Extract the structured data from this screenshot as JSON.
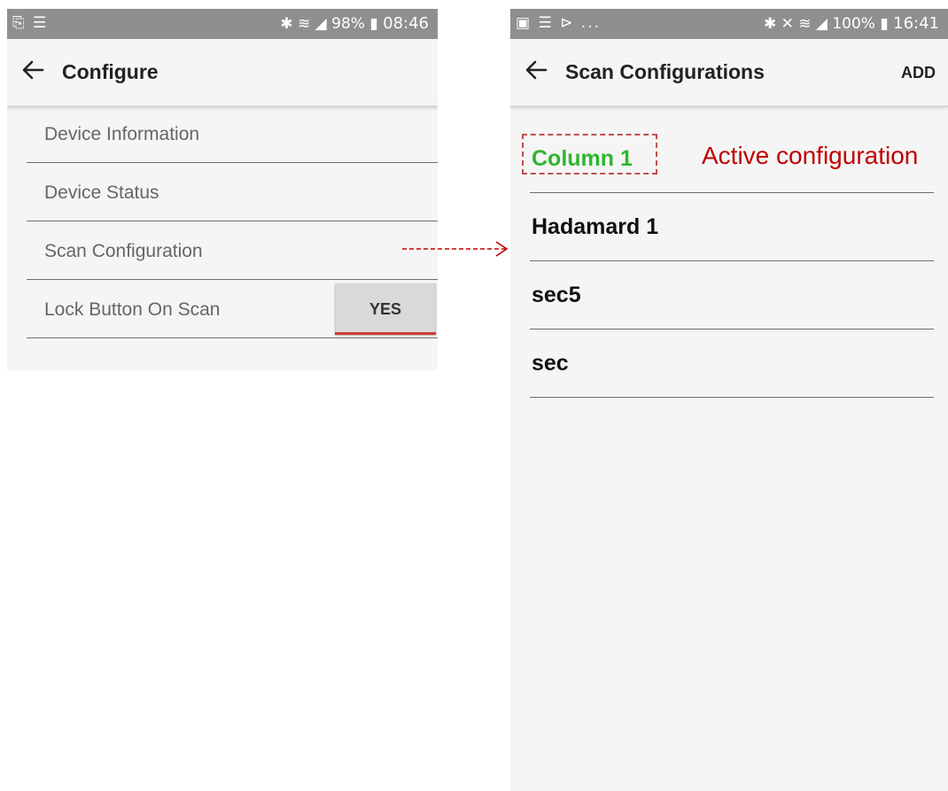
{
  "left_screen": {
    "status_bar": {
      "left_icons": "⎘ ☰",
      "right_icons": "✱ ≋ ◢ 98% ▮",
      "time": "08:46"
    },
    "app_bar": {
      "title": "Configure"
    },
    "items": [
      {
        "label": "Device Information"
      },
      {
        "label": "Device Status"
      },
      {
        "label": "Scan Configuration"
      },
      {
        "label": "Lock Button On Scan",
        "toggle_label": "YES"
      }
    ]
  },
  "right_screen": {
    "status_bar": {
      "left_icons": "▣ ☰ ⊳ ...",
      "right_icons": "✱ ✕ ≋ ◢ 100% ▮",
      "time": "16:41"
    },
    "app_bar": {
      "title": "Scan Configurations",
      "action": "ADD"
    },
    "configurations": [
      {
        "label": "Column 1",
        "active": true
      },
      {
        "label": "Hadamard 1"
      },
      {
        "label": "sec5"
      },
      {
        "label": "sec"
      }
    ]
  },
  "annotation": {
    "text": "Active configuration"
  },
  "colors": {
    "active_config": "#2fb52f",
    "annotation": "#c00000",
    "toggle_underline": "#d33a2c"
  }
}
